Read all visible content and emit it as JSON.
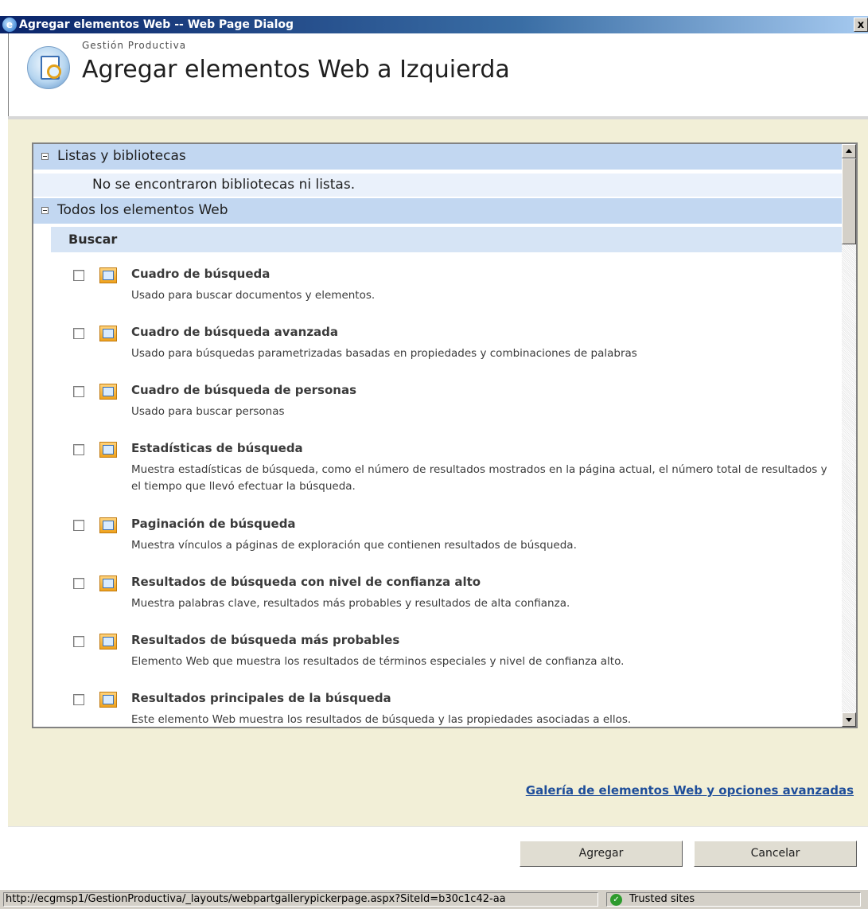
{
  "window": {
    "title": "Agregar elementos Web -- Web Page Dialog",
    "close_glyph": "x"
  },
  "header": {
    "site_name": "Gestión Productiva",
    "page_title": "Agregar elementos Web a Izquierda"
  },
  "groups": {
    "lists": {
      "label": "Listas y bibliotecas",
      "empty_message": "No se encontraron bibliotecas ni listas."
    },
    "all_web_parts": {
      "label": "Todos los elementos Web",
      "category": "Buscar"
    }
  },
  "web_parts": [
    {
      "title": "Cuadro de búsqueda",
      "description": "Usado para buscar documentos y elementos.",
      "checked": false
    },
    {
      "title": "Cuadro de búsqueda avanzada",
      "description": "Usado para búsquedas parametrizadas basadas en propiedades y combinaciones de palabras",
      "checked": false
    },
    {
      "title": "Cuadro de búsqueda de personas",
      "description": "Usado para buscar personas",
      "checked": false
    },
    {
      "title": "Estadísticas de búsqueda",
      "description": "Muestra estadísticas de búsqueda, como el número de resultados mostrados en la página actual, el número total de resultados y el tiempo que llevó efectuar la búsqueda.",
      "checked": false
    },
    {
      "title": "Paginación de búsqueda",
      "description": "Muestra vínculos a páginas de exploración que contienen resultados de búsqueda.",
      "checked": false
    },
    {
      "title": "Resultados de búsqueda con nivel de confianza alto",
      "description": "Muestra palabras clave, resultados más probables y resultados de alta confianza.",
      "checked": false
    },
    {
      "title": "Resultados de búsqueda más probables",
      "description": "Elemento Web que muestra los resultados de términos especiales y nivel de confianza alto.",
      "checked": false
    },
    {
      "title": "Resultados principales de la búsqueda",
      "description": "Este elemento Web muestra los resultados de búsqueda y las propiedades asociadas a ellos.",
      "checked": false
    }
  ],
  "links": {
    "gallery": "Galería de elementos Web y opciones avanzadas"
  },
  "buttons": {
    "add": "Agregar",
    "cancel": "Cancelar"
  },
  "statusbar": {
    "url": "http://ecgmsp1/GestionProductiva/_layouts/webpartgallerypickerpage.aspx?SiteId=b30c1c42-aa",
    "zone": "Trusted sites"
  }
}
